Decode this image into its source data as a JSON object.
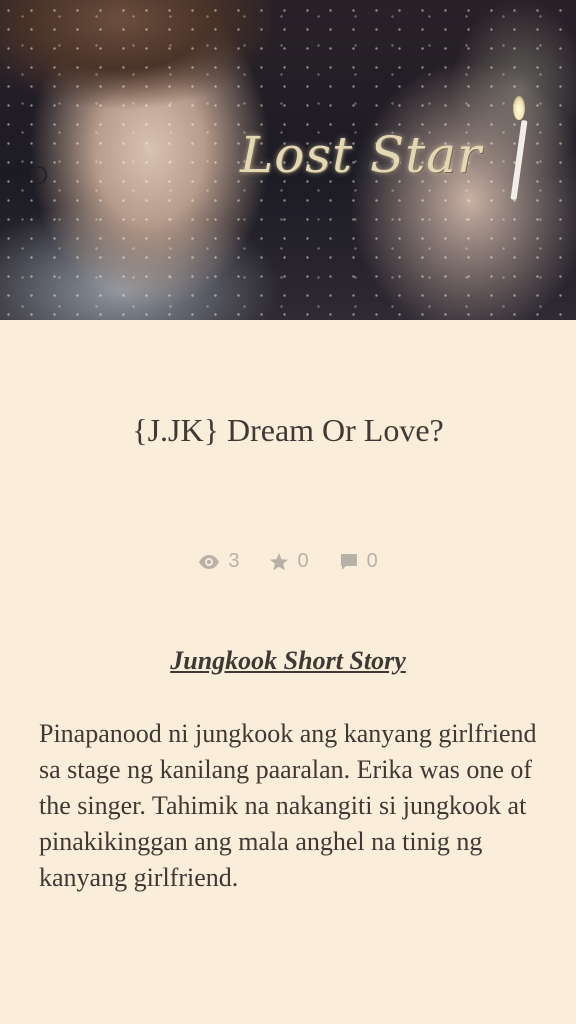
{
  "cover": {
    "logo_text": "Lost Star"
  },
  "story": {
    "title": "{J.JK}  Dream Or Love?",
    "stats": {
      "views": "3",
      "votes": "0",
      "comments": "0"
    },
    "subtitle": "Jungkook Short Story",
    "paragraph": "Pinapanood ni jungkook ang kanyang girlfriend sa stage ng kanilang paaralan. Erika was one of the singer. Tahimik na nakangiti si jungkook at pinakikinggan ang mala anghel na tinig ng kanyang girlfriend."
  },
  "colors": {
    "background": "#faeeda",
    "text": "#3f3935",
    "stat_gray": "#b8b1a8",
    "logo": "#e4d7b3"
  }
}
